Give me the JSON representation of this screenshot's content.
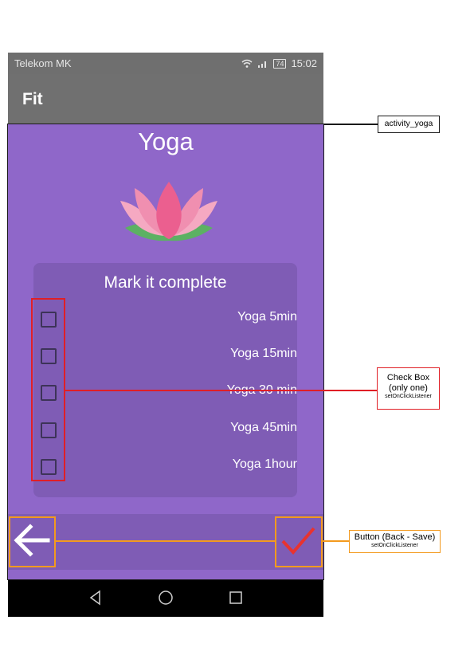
{
  "status_bar": {
    "carrier": "Telekom MK",
    "battery": "74",
    "time": "15:02"
  },
  "toolbar": {
    "title": "Fit"
  },
  "screen": {
    "title": "Yoga",
    "card_title": "Mark it complete",
    "options": [
      {
        "label": "Yoga 5min",
        "checked": false
      },
      {
        "label": "Yoga 15min",
        "checked": false
      },
      {
        "label": "Yoga 30 min",
        "checked": false
      },
      {
        "label": "Yoga 45min",
        "checked": false
      },
      {
        "label": "Yoga 1hour",
        "checked": false
      }
    ]
  },
  "annotations": {
    "layout": "activity_yoga",
    "checkbox_title": "Check Box",
    "checkbox_note": "(only one)",
    "checkbox_listener": "setOnClickListener",
    "button_title": "Button (Back - Save)",
    "button_listener": "setOnClickListener"
  },
  "colors": {
    "background": "#8f67c9",
    "card": "#7f5cb5",
    "save_check": "#e8332f",
    "checkbox_annotation": "#e01f26",
    "button_annotation": "#f39a1e"
  },
  "icons": [
    "wifi-icon",
    "signal-icon",
    "battery-icon",
    "lotus-image",
    "back-arrow-icon",
    "checkmark-icon",
    "nav-back-icon",
    "nav-home-icon",
    "nav-recents-icon"
  ]
}
